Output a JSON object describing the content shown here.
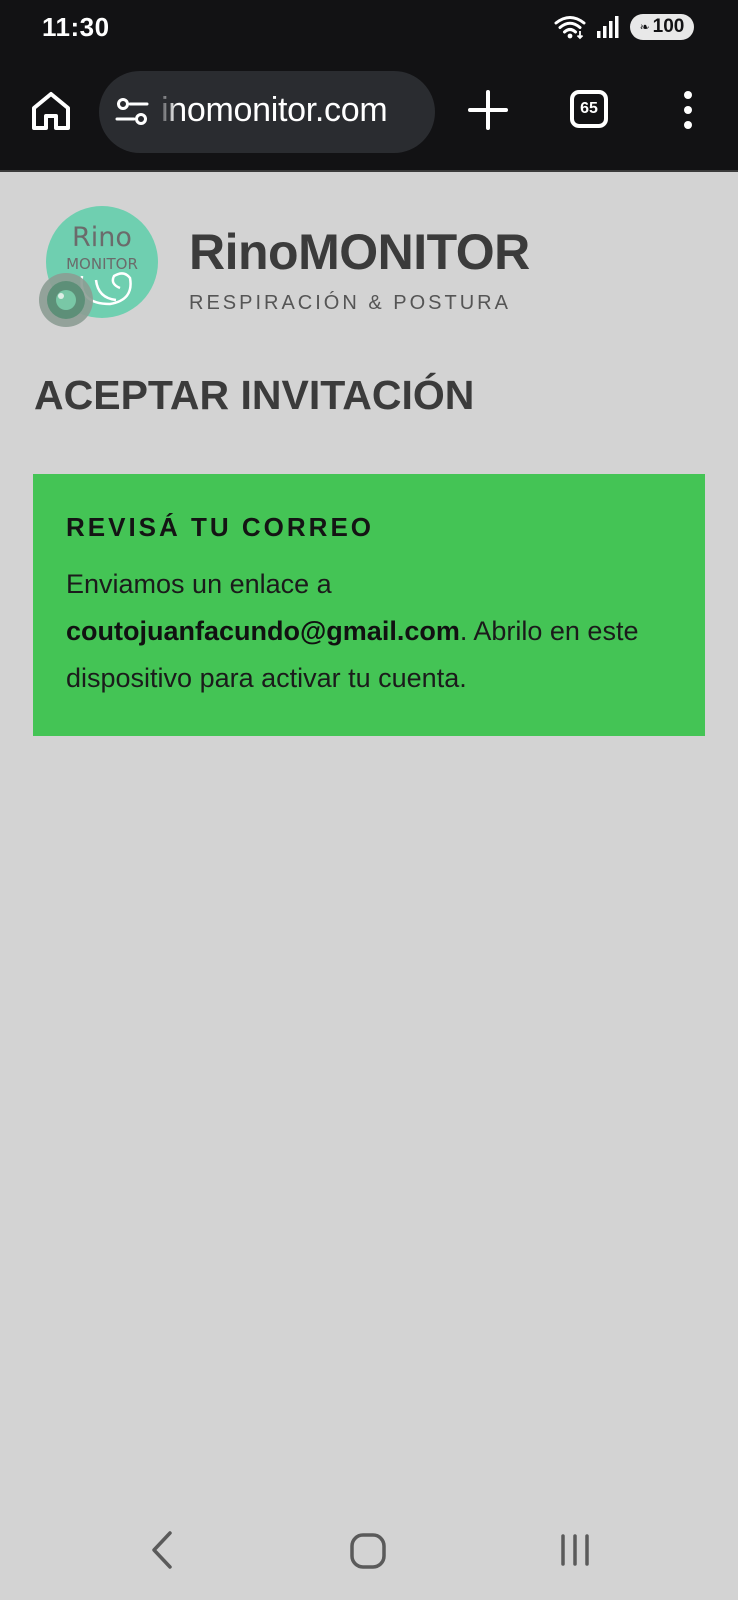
{
  "status_bar": {
    "time": "11:30",
    "battery": "100"
  },
  "browser": {
    "url": "inomonitor.com",
    "tab_count": "65"
  },
  "brand": {
    "logo_top": "Rino",
    "logo_bottom": "MONITOR",
    "name": "RinoMONITOR",
    "tagline": "RESPIRACIÓN & POSTURA"
  },
  "page": {
    "title": "ACEPTAR INVITACIÓN"
  },
  "alert": {
    "title": "REVISÁ TU CORREO",
    "body_prefix": "Enviamos un enlace a ",
    "email": "coutojuanfacundo@gmail.com",
    "body_suffix": ". Abrilo en este dispositivo para activar tu cuenta."
  },
  "colors": {
    "alert_bg": "#44c455",
    "logo_teal": "#6fcfb0",
    "page_bg": "#d3d3d3",
    "bar_bg": "#121214"
  }
}
